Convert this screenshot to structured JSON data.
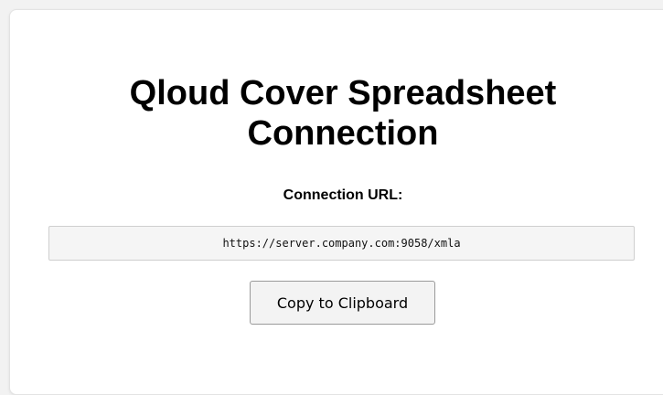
{
  "page": {
    "title_line1": "Qloud Cover Spreadsheet",
    "title_line2": "Connection"
  },
  "connection": {
    "label": "Connection URL:",
    "url": "https://server.company.com:9058/xmla"
  },
  "actions": {
    "copy_label": "Copy to Clipboard"
  }
}
